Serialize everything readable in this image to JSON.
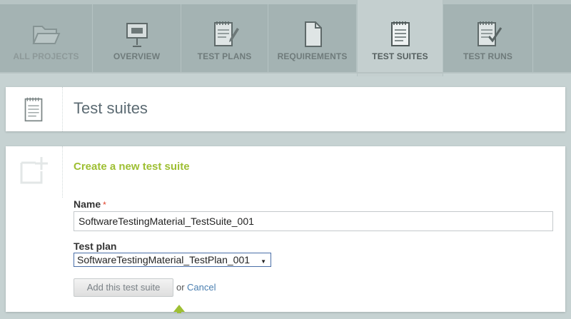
{
  "nav": {
    "tabs": [
      {
        "label": "ALL PROJECTS",
        "icon": "folder-icon",
        "state": "dim"
      },
      {
        "label": "OVERVIEW",
        "icon": "presentation-board-icon",
        "state": "normal"
      },
      {
        "label": "TEST PLANS",
        "icon": "notepad-pencil-icon",
        "state": "normal"
      },
      {
        "label": "REQUIREMENTS",
        "icon": "document-icon",
        "state": "normal"
      },
      {
        "label": "TEST SUITES",
        "icon": "notepad-icon",
        "state": "active"
      },
      {
        "label": "TEST RUNS",
        "icon": "notepad-check-icon",
        "state": "normal"
      }
    ]
  },
  "header": {
    "title": "Test suites",
    "icon": "notepad-icon"
  },
  "form": {
    "title": "Create a new test suite",
    "icon": "add-page-icon",
    "name_label": "Name",
    "required_mark": "*",
    "name_value": "SoftwareTestingMaterial_TestSuite_001",
    "plan_label": "Test plan",
    "plan_selected": "SoftwareTestingMaterial_TestPlan_001",
    "submit_label": "Add this test suite",
    "or_text": "or",
    "cancel_label": "Cancel"
  },
  "colors": {
    "nav_bg": "#a4b3b3",
    "active_tab": "#c4cfcf",
    "form_title": "#9ebf33",
    "link": "#4a7fb0",
    "required": "#e0412a"
  }
}
